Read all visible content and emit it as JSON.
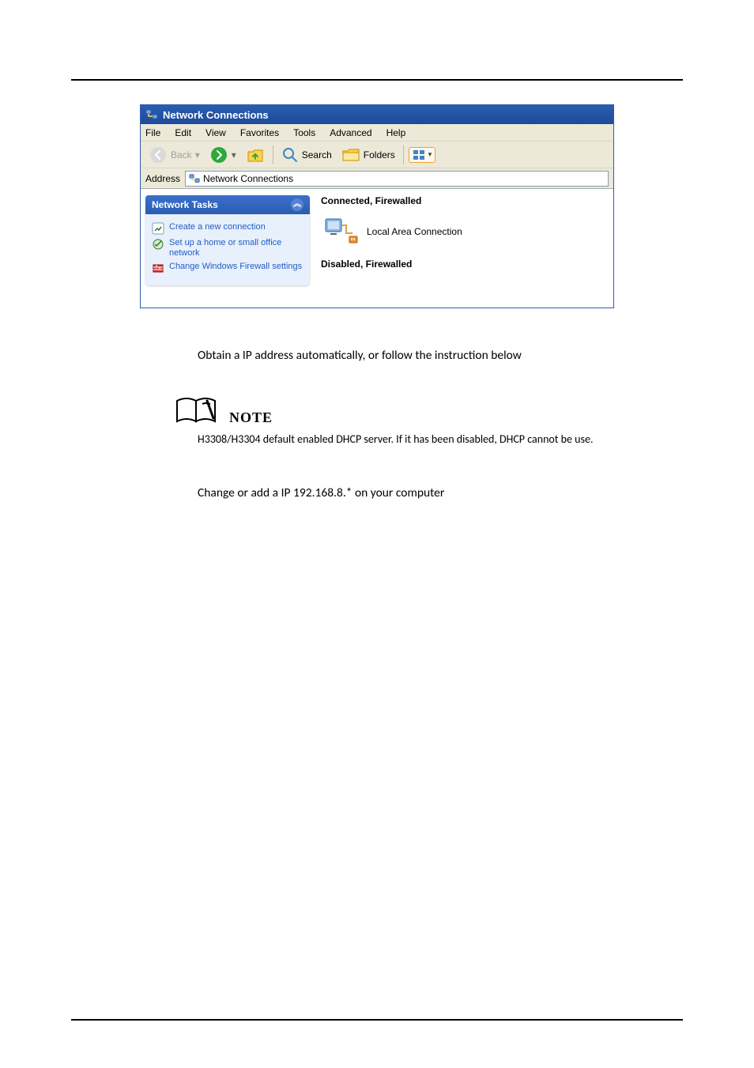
{
  "window": {
    "title": "Network Connections",
    "menubar": [
      "File",
      "Edit",
      "View",
      "Favorites",
      "Tools",
      "Advanced",
      "Help"
    ],
    "toolbar": {
      "back": "Back",
      "search": "Search",
      "folders": "Folders"
    },
    "addressbar": {
      "label": "Address",
      "value": "Network Connections"
    },
    "tasks": {
      "header": "Network Tasks",
      "items": [
        "Create a new connection",
        "Set up a home or small office network",
        "Change Windows Firewall settings"
      ]
    },
    "groups": {
      "connected": "Connected, Firewalled",
      "disabled": "Disabled, Firewalled"
    },
    "connection": {
      "name": "Local Area Connection"
    }
  },
  "doc": {
    "line1": "Obtain a IP address automatically, or follow the instruction below",
    "note_label": "NOTE",
    "note_text": "H3308/H3304 default enabled DHCP server. If it has been disabled, DHCP cannot be use.",
    "line2": "Change or add a IP 192.168.8.* on your computer"
  }
}
